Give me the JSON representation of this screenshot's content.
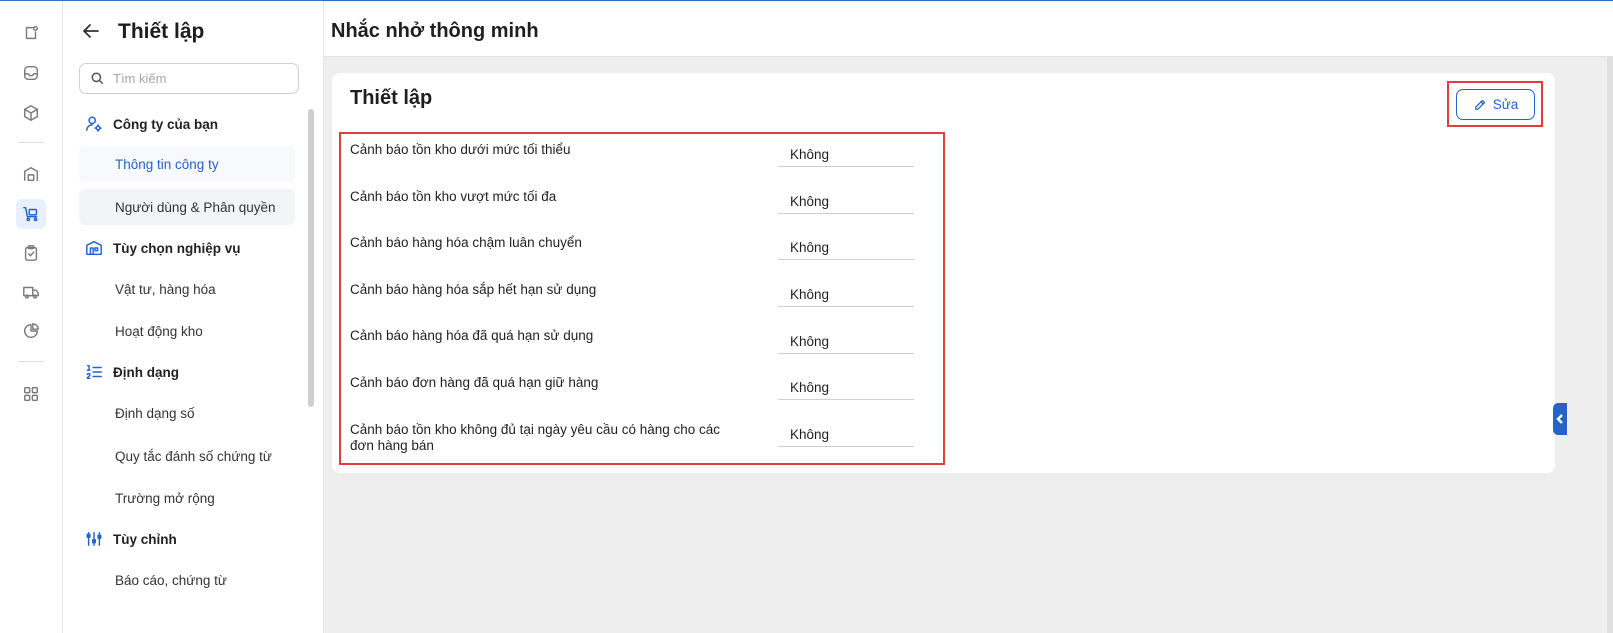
{
  "sidebar": {
    "title": "Thiết lập",
    "search_placeholder": "Tìm kiếm",
    "sections": [
      {
        "label": "Công ty của bạn",
        "icon": "user-gear-icon"
      },
      {
        "label": "Tùy chọn nghiệp vụ",
        "icon": "building-icon"
      },
      {
        "label": "Định dạng",
        "icon": "numbered-list-icon"
      },
      {
        "label": "Tùy chỉnh",
        "icon": "sliders-icon"
      }
    ],
    "items": [
      "Thông tin công ty",
      "Người dùng & Phân quyền",
      "Vật tư, hàng hóa",
      "Hoạt động kho",
      "Định dạng số",
      "Quy tắc đánh số chứng từ",
      "Trường mở rộng",
      "Báo cáo, chứng từ"
    ],
    "selected_item": "Thông tin công ty"
  },
  "rail_icons": [
    "dashboard-icon",
    "inbox-icon",
    "box-icon",
    "warehouse-icon",
    "cart-icon",
    "clipboard-check-icon",
    "truck-icon",
    "pie-chart-icon",
    "apps-grid-icon"
  ],
  "page": {
    "title": "Nhắc nhở thông minh",
    "card_title": "Thiết lập",
    "edit_label": "Sửa",
    "settings": [
      {
        "label": "Cảnh báo tồn kho dưới mức tối thiểu",
        "value": "Không"
      },
      {
        "label": "Cảnh báo tồn kho vượt mức tối đa",
        "value": "Không"
      },
      {
        "label": "Cảnh báo hàng hóa chậm luân chuyển",
        "value": "Không"
      },
      {
        "label": "Cảnh báo hàng hóa sắp hết hạn sử dụng",
        "value": "Không"
      },
      {
        "label": "Cảnh báo hàng hóa đã quá hạn sử dụng",
        "value": "Không"
      },
      {
        "label": "Cảnh báo đơn hàng đã quá hạn giữ hàng",
        "value": "Không"
      },
      {
        "label": "Cảnh báo tồn kho không đủ tại ngày yêu cầu có hàng cho các đơn hàng bán",
        "value": "Không"
      }
    ]
  },
  "colors": {
    "accent": "#2563c9",
    "highlight": "#e03d3d",
    "background": "#eeeeee"
  }
}
